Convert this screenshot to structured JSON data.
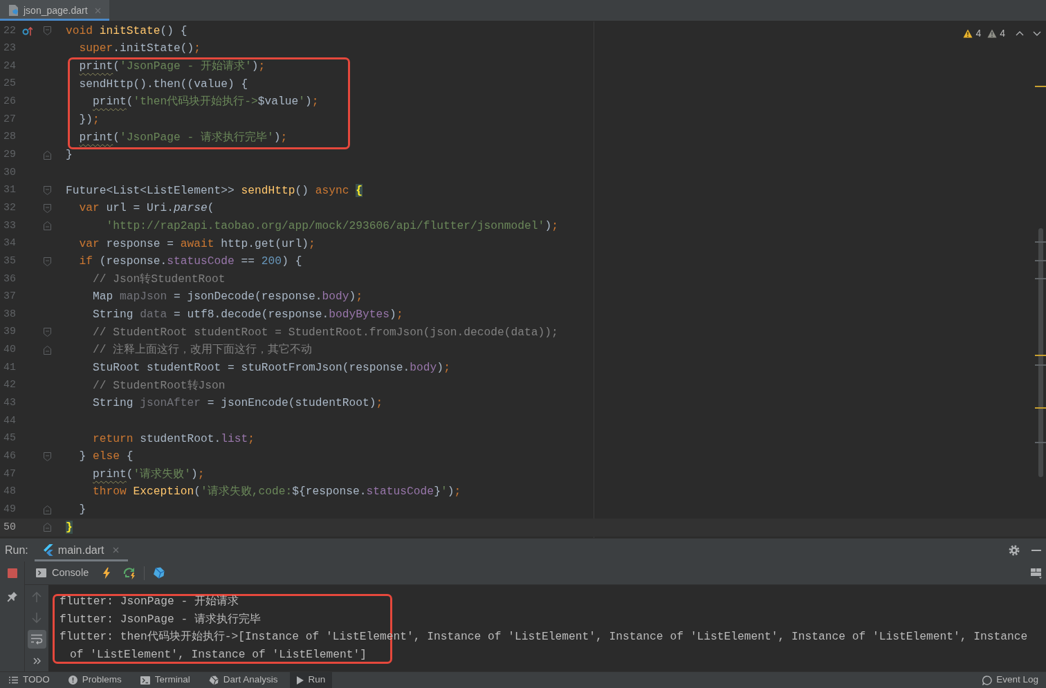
{
  "editor_tabs": [
    {
      "label": "json_page.dart",
      "selected": true
    }
  ],
  "inspections": [
    {
      "kind": "warning",
      "count": "4"
    },
    {
      "kind": "weak_warning",
      "count": "4"
    }
  ],
  "editor": {
    "lines": [
      {
        "number": "22",
        "current": false,
        "highlighted": false,
        "fold_start": true,
        "override": true,
        "tokens": [
          {
            "kind": "kw",
            "text": "void "
          },
          {
            "kind": "fn",
            "text": "initState"
          },
          {
            "kind": "plain",
            "text": "() {"
          }
        ]
      },
      {
        "number": "23",
        "current": false,
        "highlighted": false,
        "tokens": [
          {
            "kind": "kw",
            "text": "  super"
          },
          {
            "kind": "plain",
            "text": ".initState()"
          },
          {
            "kind": "punct",
            "text": ";"
          }
        ]
      },
      {
        "number": "24",
        "current": false,
        "highlighted": true,
        "tokens": [
          {
            "kind": "warn",
            "text": "  print"
          },
          {
            "kind": "plain",
            "text": "("
          },
          {
            "kind": "str",
            "text": "'JsonPage - 开始请求'"
          },
          {
            "kind": "plain",
            "text": ")"
          },
          {
            "kind": "punct",
            "text": ";"
          }
        ]
      },
      {
        "number": "25",
        "current": false,
        "highlighted": true,
        "tokens": [
          {
            "kind": "plain",
            "text": "  sendHttp().then((value) {"
          }
        ]
      },
      {
        "number": "26",
        "current": false,
        "highlighted": true,
        "tokens": [
          {
            "kind": "warn",
            "text": "    print"
          },
          {
            "kind": "plain",
            "text": "("
          },
          {
            "kind": "str",
            "text": "'then代码块开始执行->"
          },
          {
            "kind": "plain",
            "text": "$value"
          },
          {
            "kind": "str",
            "text": "'"
          },
          {
            "kind": "plain",
            "text": ")"
          },
          {
            "kind": "punct",
            "text": ";"
          }
        ]
      },
      {
        "number": "27",
        "current": false,
        "highlighted": true,
        "tokens": [
          {
            "kind": "plain",
            "text": "  })"
          },
          {
            "kind": "punct",
            "text": ";"
          }
        ]
      },
      {
        "number": "28",
        "current": false,
        "highlighted": true,
        "tokens": [
          {
            "kind": "warn",
            "text": "  print"
          },
          {
            "kind": "plain",
            "text": "("
          },
          {
            "kind": "str",
            "text": "'JsonPage - 请求执行完毕'"
          },
          {
            "kind": "plain",
            "text": ")"
          },
          {
            "kind": "punct",
            "text": ";"
          }
        ]
      },
      {
        "number": "29",
        "current": false,
        "highlighted": false,
        "fold_end": true,
        "tokens": [
          {
            "kind": "plain",
            "text": "}"
          }
        ]
      },
      {
        "number": "30",
        "current": false,
        "highlighted": false
      },
      {
        "number": "31",
        "current": false,
        "highlighted": false,
        "fold_start": true,
        "tokens": [
          {
            "kind": "plain",
            "text": "Future<List<ListElement>> "
          },
          {
            "kind": "fn",
            "text": "sendHttp"
          },
          {
            "kind": "plain",
            "text": "() "
          },
          {
            "kind": "kw",
            "text": "async "
          },
          {
            "kind": "match",
            "text": "{"
          }
        ]
      },
      {
        "number": "32",
        "current": false,
        "highlighted": false,
        "fold_start": true,
        "tokens": [
          {
            "kind": "kw",
            "text": "  var "
          },
          {
            "kind": "plain",
            "text": "url = Uri."
          },
          {
            "kind": "static",
            "text": "parse"
          },
          {
            "kind": "plain",
            "text": "("
          }
        ]
      },
      {
        "number": "33",
        "current": false,
        "highlighted": false,
        "fold_end": true,
        "tokens": [
          {
            "kind": "str",
            "text": "      'http://rap2api.taobao.org/app/mock/293606/api/flutter/jsonmodel'"
          },
          {
            "kind": "plain",
            "text": ")"
          },
          {
            "kind": "punct",
            "text": ";"
          }
        ]
      },
      {
        "number": "34",
        "current": false,
        "highlighted": false,
        "tokens": [
          {
            "kind": "kw",
            "text": "  var "
          },
          {
            "kind": "plain",
            "text": "response = "
          },
          {
            "kind": "kw",
            "text": "await "
          },
          {
            "kind": "plain",
            "text": "http.get(url)"
          },
          {
            "kind": "punct",
            "text": ";"
          }
        ]
      },
      {
        "number": "35",
        "current": false,
        "highlighted": false,
        "fold_start": true,
        "tokens": [
          {
            "kind": "kw",
            "text": "  if "
          },
          {
            "kind": "plain",
            "text": "(response."
          },
          {
            "kind": "field",
            "text": "statusCode"
          },
          {
            "kind": "plain",
            "text": " == "
          },
          {
            "kind": "num",
            "text": "200"
          },
          {
            "kind": "plain",
            "text": ") {"
          }
        ]
      },
      {
        "number": "36",
        "current": false,
        "highlighted": false,
        "tokens": [
          {
            "kind": "comment",
            "text": "    // Json转StudentRoot"
          }
        ]
      },
      {
        "number": "37",
        "current": false,
        "highlighted": false,
        "tokens": [
          {
            "kind": "plain",
            "text": "    Map "
          },
          {
            "kind": "unused",
            "text": "mapJson"
          },
          {
            "kind": "plain",
            "text": " = jsonDecode(response."
          },
          {
            "kind": "field",
            "text": "body"
          },
          {
            "kind": "plain",
            "text": ")"
          },
          {
            "kind": "punct",
            "text": ";"
          }
        ]
      },
      {
        "number": "38",
        "current": false,
        "highlighted": false,
        "tokens": [
          {
            "kind": "plain",
            "text": "    String "
          },
          {
            "kind": "unused",
            "text": "data"
          },
          {
            "kind": "plain",
            "text": " = utf8.decode(response."
          },
          {
            "kind": "field",
            "text": "bodyBytes"
          },
          {
            "kind": "plain",
            "text": ")"
          },
          {
            "kind": "punct",
            "text": ";"
          }
        ]
      },
      {
        "number": "39",
        "current": false,
        "highlighted": false,
        "fold_start": true,
        "tokens": [
          {
            "kind": "comment",
            "text": "    // StudentRoot studentRoot = StudentRoot.fromJson(json.decode(data));"
          }
        ]
      },
      {
        "number": "40",
        "current": false,
        "highlighted": false,
        "fold_end": true,
        "tokens": [
          {
            "kind": "comment",
            "text": "    // 注释上面这行，改用下面这行，其它不动"
          }
        ]
      },
      {
        "number": "41",
        "current": false,
        "highlighted": false,
        "tokens": [
          {
            "kind": "plain",
            "text": "    StuRoot studentRoot = stuRootFromJson(response."
          },
          {
            "kind": "field",
            "text": "body"
          },
          {
            "kind": "plain",
            "text": ")"
          },
          {
            "kind": "punct",
            "text": ";"
          }
        ]
      },
      {
        "number": "42",
        "current": false,
        "highlighted": false,
        "tokens": [
          {
            "kind": "comment",
            "text": "    // StudentRoot转Json"
          }
        ]
      },
      {
        "number": "43",
        "current": false,
        "highlighted": false,
        "tokens": [
          {
            "kind": "plain",
            "text": "    String "
          },
          {
            "kind": "unused",
            "text": "jsonAfter"
          },
          {
            "kind": "plain",
            "text": " = jsonEncode(studentRoot)"
          },
          {
            "kind": "punct",
            "text": ";"
          }
        ]
      },
      {
        "number": "44",
        "current": false,
        "highlighted": false
      },
      {
        "number": "45",
        "current": false,
        "highlighted": false,
        "tokens": [
          {
            "kind": "kw",
            "text": "    return "
          },
          {
            "kind": "plain",
            "text": "studentRoot."
          },
          {
            "kind": "field",
            "text": "list"
          },
          {
            "kind": "punct",
            "text": ";"
          }
        ]
      },
      {
        "number": "46",
        "current": false,
        "highlighted": false,
        "fold_start": true,
        "tokens": [
          {
            "kind": "plain",
            "text": "  } "
          },
          {
            "kind": "kw",
            "text": "else "
          },
          {
            "kind": "plain",
            "text": "{"
          }
        ]
      },
      {
        "number": "47",
        "current": false,
        "highlighted": false,
        "tokens": [
          {
            "kind": "warn",
            "text": "    print"
          },
          {
            "kind": "plain",
            "text": "("
          },
          {
            "kind": "str",
            "text": "'请求失败'"
          },
          {
            "kind": "plain",
            "text": ")"
          },
          {
            "kind": "punct",
            "text": ";"
          }
        ]
      },
      {
        "number": "48",
        "current": false,
        "highlighted": false,
        "tokens": [
          {
            "kind": "kw",
            "text": "    throw "
          },
          {
            "kind": "fn",
            "text": "Exception"
          },
          {
            "kind": "plain",
            "text": "("
          },
          {
            "kind": "str",
            "text": "'请求失败,code:"
          },
          {
            "kind": "plain",
            "text": "${response."
          },
          {
            "kind": "field",
            "text": "statusCode"
          },
          {
            "kind": "plain",
            "text": "}"
          },
          {
            "kind": "str",
            "text": "'"
          },
          {
            "kind": "plain",
            "text": ")"
          },
          {
            "kind": "punct",
            "text": ";"
          }
        ]
      },
      {
        "number": "49",
        "current": false,
        "highlighted": false,
        "fold_end": true,
        "tokens": [
          {
            "kind": "plain",
            "text": "  }"
          }
        ]
      },
      {
        "number": "50",
        "current": true,
        "highlighted": false,
        "fold_end": true,
        "tokens": [
          {
            "kind": "match",
            "text": "}"
          }
        ]
      }
    ]
  },
  "run_panel": {
    "title": "Run:",
    "tabs": [
      {
        "label": "main.dart",
        "selected": true
      }
    ],
    "toolbar": [
      {
        "kind": "console",
        "label": "Console"
      },
      {
        "kind": "hot_reload"
      },
      {
        "kind": "hot_restart"
      },
      {
        "kind": "devtools"
      }
    ],
    "side_tools": [
      {
        "kind": "up",
        "disabled": true,
        "on": false
      },
      {
        "kind": "down",
        "disabled": true,
        "on": false
      },
      {
        "kind": "wrap",
        "disabled": false,
        "on": true
      },
      {
        "kind": "more",
        "disabled": false,
        "on": false
      }
    ],
    "console_lines": [
      {
        "text": "flutter: JsonPage - 开始请求",
        "highlighted": true
      },
      {
        "text": "flutter: JsonPage - 请求执行完毕",
        "highlighted": true
      },
      {
        "text": "flutter: then代码块开始执行->[Instance of 'ListElement', Instance of 'ListElement', Instance of 'ListElement', Instance of 'ListElement', Instance of 'ListElement', Instance of 'ListElement']",
        "highlighted": true
      }
    ]
  },
  "tool_windows": [
    {
      "kind": "todo",
      "label": "TODO",
      "selected": false
    },
    {
      "kind": "problems",
      "label": "Problems",
      "selected": false
    },
    {
      "kind": "terminal",
      "label": "Terminal",
      "selected": false
    },
    {
      "kind": "dart_analysis",
      "label": "Dart Analysis",
      "selected": false
    },
    {
      "kind": "run",
      "label": "Run",
      "selected": true
    }
  ],
  "event_log": {
    "label": "Event Log"
  }
}
